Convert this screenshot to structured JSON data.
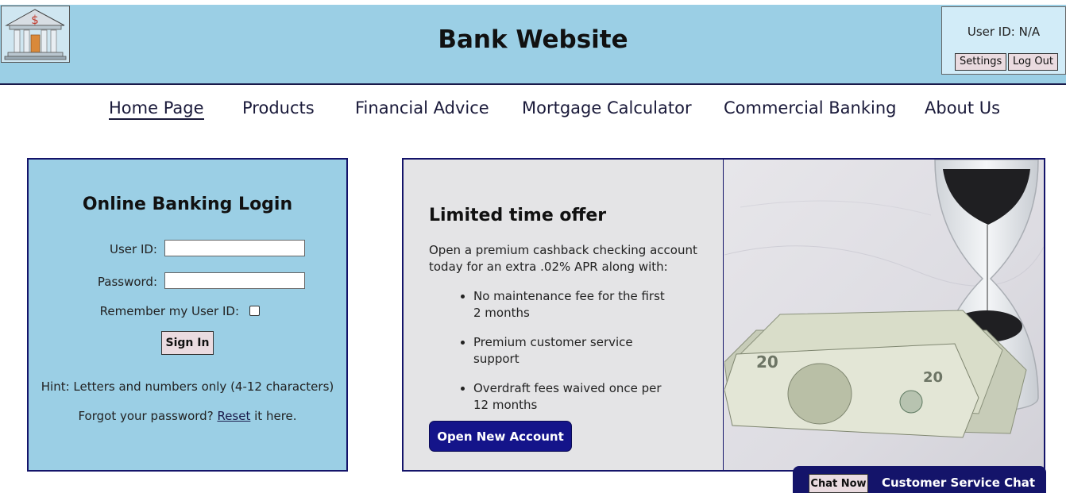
{
  "header": {
    "title": "Bank Website",
    "logo_symbol": "$",
    "user_id_text": "User ID: N/A",
    "settings_label": "Settings",
    "logout_label": "Log Out"
  },
  "nav": {
    "items": [
      {
        "label": "Home Page",
        "active": true
      },
      {
        "label": "Products"
      },
      {
        "label": "Financial Advice"
      },
      {
        "label": "Mortgage Calculator"
      },
      {
        "label": "Commercial Banking"
      },
      {
        "label": "About Us"
      }
    ]
  },
  "login": {
    "title": "Online Banking Login",
    "user_id_label": "User ID:",
    "user_id_value": "",
    "password_label": "Password:",
    "password_value": "",
    "remember_label": "Remember my User ID:",
    "remember_checked": false,
    "sign_in_label": "Sign In",
    "hint": "Hint: Letters and numbers only (4-12 characters)",
    "forgot_prefix": "Forgot your password?",
    "forgot_link": "Reset",
    "forgot_suffix": "it here."
  },
  "offer": {
    "title": "Limited time offer",
    "description": "Open a premium cashback checking account today for an extra .02% APR along with:",
    "bullets": [
      "No maintenance fee for the first 2 months",
      "Premium customer service support",
      "Overdraft fees waived once per 12 months"
    ],
    "button_label": "Open New Account"
  },
  "chat": {
    "button_label": "Chat Now",
    "label": "Customer Service Chat"
  },
  "colors": {
    "header_bg": "#9bcfe5",
    "navy": "#14146a",
    "button_pink": "#eadbe0",
    "offer_bg": "#e4e4e6"
  }
}
